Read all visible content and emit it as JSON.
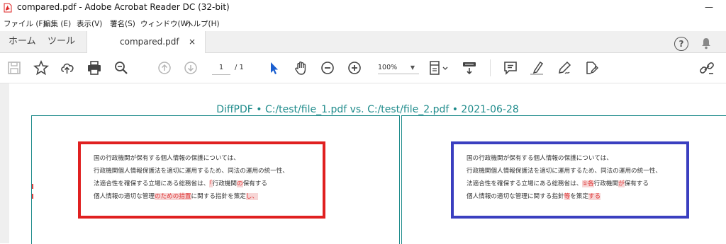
{
  "window": {
    "title": "compared.pdf - Adobe Acrobat Reader DC (32-bit)",
    "minimize_glyph": "—"
  },
  "menu": [
    "ファイル (F)",
    "編集 (E)",
    "表示(V)",
    "署名(S)",
    "ウィンドウ(W)",
    "ヘルプ(H)"
  ],
  "tabs": {
    "home": "ホーム",
    "tools": "ツール",
    "document": "compared.pdf",
    "close_glyph": "×",
    "help_glyph": "?"
  },
  "toolbar": {
    "icons": [
      "save-icon",
      "bookmark-star-icon",
      "upload-cloud-icon",
      "print-icon",
      "zoom-search-icon",
      "page-up-icon",
      "page-down-icon",
      "select-arrow-icon",
      "hand-tool-icon",
      "zoom-out-icon",
      "zoom-in-icon",
      "fit-page-icon",
      "scroll-mode-icon",
      "comment-icon",
      "highlight-pen-icon",
      "sign-pen-icon",
      "fill-sign-icon",
      "share-link-icon"
    ],
    "page_current": "1",
    "page_total": "/ 1",
    "zoom": "100%",
    "accent_color": "#1a5fd0"
  },
  "document": {
    "header": "DiffPDF • C:/test/file_1.pdf vs. C:/test/file_2.pdf • 2021-06-28",
    "header_color": "#1e8b8b",
    "left_box_color": "#e02020",
    "right_box_color": "#3a3fc0",
    "left_text": {
      "line1": "国の行政機関が保有する個人情報の保護については、",
      "line2": "行政機関個人情報保護法を適切に運用するため、同法の運用の統一性、",
      "line3_a": "法適合性を確保する立場にある総務省は、",
      "line3_hl1": "「",
      "line3_b": "行政機関",
      "line3_hl2": "の",
      "line3_c": "保有する",
      "line4_a": "個人情報の適切な管理",
      "line4_hl1": "のための措置",
      "line4_b": "に関する指針を策定",
      "line4_hl2": "し、"
    },
    "right_text": {
      "line1": "国の行政機関が保有する個人情報の保護については、",
      "line2": "行政機関個人情報保護法を適切に運用するため、同法の運用の統一性、",
      "line3_a": "法適合性を確保する立場にある総務省は、",
      "line3_hl1": "①各",
      "line3_b": "行政機関",
      "line3_hl2": "が",
      "line3_c": "保有する",
      "line4_a": "個人情報の適切な管理に関する指針",
      "line4_hl1": "等",
      "line4_b": "を策定",
      "line4_hl2": "する"
    }
  }
}
